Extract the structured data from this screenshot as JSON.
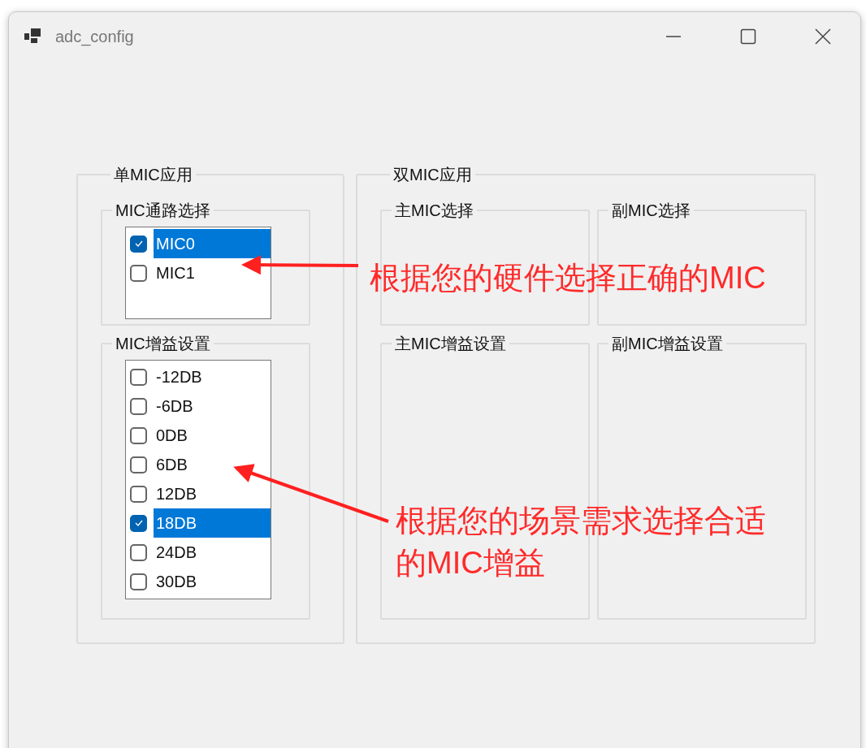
{
  "window": {
    "title": "adc_config"
  },
  "single_mic": {
    "title": "单MIC应用",
    "channel_group": {
      "title": "MIC通路选择",
      "items": [
        {
          "label": "MIC0",
          "checked": true,
          "selected": true
        },
        {
          "label": "MIC1",
          "checked": false,
          "selected": false
        }
      ]
    },
    "gain_group": {
      "title": "MIC增益设置",
      "items": [
        {
          "label": "-12DB",
          "checked": false,
          "selected": false
        },
        {
          "label": "-6DB",
          "checked": false,
          "selected": false
        },
        {
          "label": "0DB",
          "checked": false,
          "selected": false
        },
        {
          "label": "6DB",
          "checked": false,
          "selected": false
        },
        {
          "label": "12DB",
          "checked": false,
          "selected": false
        },
        {
          "label": "18DB",
          "checked": true,
          "selected": true
        },
        {
          "label": "24DB",
          "checked": false,
          "selected": false
        },
        {
          "label": "30DB",
          "checked": false,
          "selected": false
        }
      ]
    }
  },
  "dual_mic": {
    "title": "双MIC应用",
    "groups": [
      "主MIC选择",
      "副MIC选择",
      "主MIC增益设置",
      "副MIC增益设置"
    ]
  },
  "annotations": [
    "根据您的硬件选择正确的MIC",
    "根据您的场景需求选择合适的MIC增益"
  ]
}
